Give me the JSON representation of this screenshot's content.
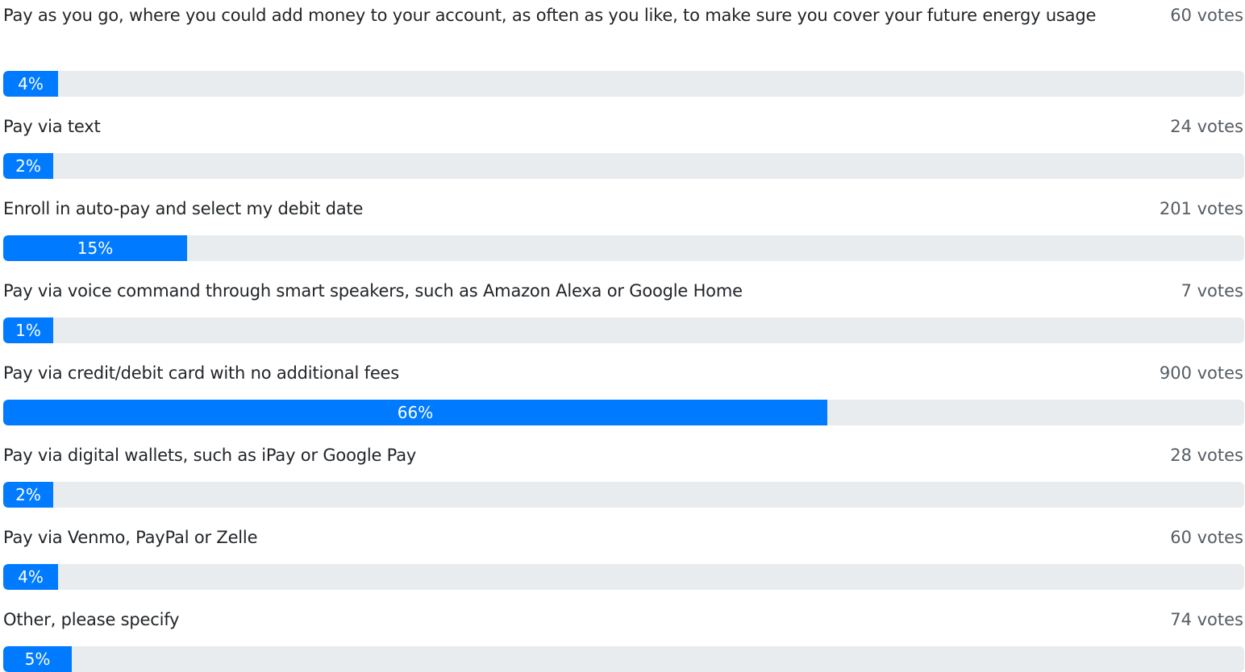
{
  "poll": {
    "options": [
      {
        "label": "Pay as you go, where you could add money to your account, as often as you like, to make sure you cover your future energy usage",
        "votes": "60 votes",
        "percent_label": "4%",
        "percent": 4.4
      },
      {
        "label": "Pay via text",
        "votes": "24 votes",
        "percent_label": "2%",
        "percent": 1.8
      },
      {
        "label": "Enroll in auto-pay and select my debit date",
        "votes": "201 votes",
        "percent_label": "15%",
        "percent": 14.8
      },
      {
        "label": "Pay via voice command through smart speakers, such as Amazon Alexa or Google Home",
        "votes": "7 votes",
        "percent_label": "1%",
        "percent": 0.5
      },
      {
        "label": "Pay via credit/debit card with no additional fees",
        "votes": "900 votes",
        "percent_label": "66%",
        "percent": 66.4
      },
      {
        "label": "Pay via digital wallets, such as iPay or Google Pay",
        "votes": "28 votes",
        "percent_label": "2%",
        "percent": 2.1
      },
      {
        "label": "Pay via Venmo, PayPal or Zelle",
        "votes": "60 votes",
        "percent_label": "4%",
        "percent": 4.4
      },
      {
        "label": "Other, please specify",
        "votes": "74 votes",
        "percent_label": "5%",
        "percent": 5.5
      }
    ]
  },
  "colors": {
    "bar_fill": "#007bff",
    "bar_track": "#e9ecef",
    "label_text": "#212529",
    "votes_text": "#555c63"
  }
}
